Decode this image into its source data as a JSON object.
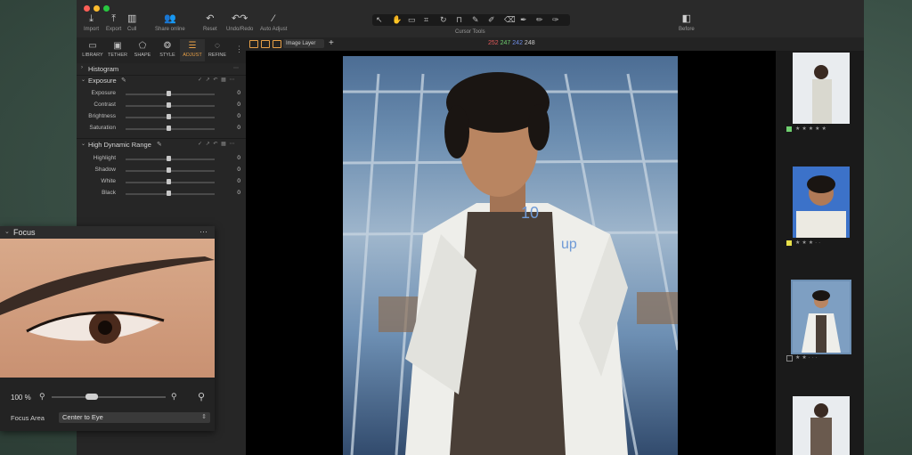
{
  "toolbar": {
    "import": "Import",
    "export": "Export",
    "cull": "Cull",
    "share_online": "Share online",
    "reset": "Reset",
    "undo_redo": "Undo/Redo",
    "auto_adjust": "Auto Adjust",
    "cursor_tools": "Cursor Tools",
    "before": "Before"
  },
  "tabs": [
    "LIBRARY",
    "TETHER",
    "SHAPE",
    "STYLE",
    "ADJUST",
    "REFINE"
  ],
  "active_tab": "ADJUST",
  "panel": {
    "histogram": "Histogram",
    "exposure": {
      "title": "Exposure",
      "rows": [
        {
          "label": "Exposure",
          "value": "0"
        },
        {
          "label": "Contrast",
          "value": "0"
        },
        {
          "label": "Brightness",
          "value": "0"
        },
        {
          "label": "Saturation",
          "value": "0"
        }
      ]
    },
    "hdr": {
      "title": "High Dynamic Range",
      "rows": [
        {
          "label": "Highlight",
          "value": "0"
        },
        {
          "label": "Shadow",
          "value": "0"
        },
        {
          "label": "White",
          "value": "0"
        },
        {
          "label": "Black",
          "value": "0"
        }
      ]
    }
  },
  "viewer": {
    "layer": "Image Layer",
    "rgb": {
      "r": "252",
      "g": "247",
      "b": "242",
      "l": "248"
    }
  },
  "focus": {
    "title": "Focus",
    "zoom": "100 %",
    "area_label": "Focus Area",
    "area_value": "Center to Eye"
  },
  "colors": {
    "accent": "#e8a047",
    "red": "#e25a5a",
    "green": "#6fcf6f",
    "blue": "#6f8fe8"
  }
}
